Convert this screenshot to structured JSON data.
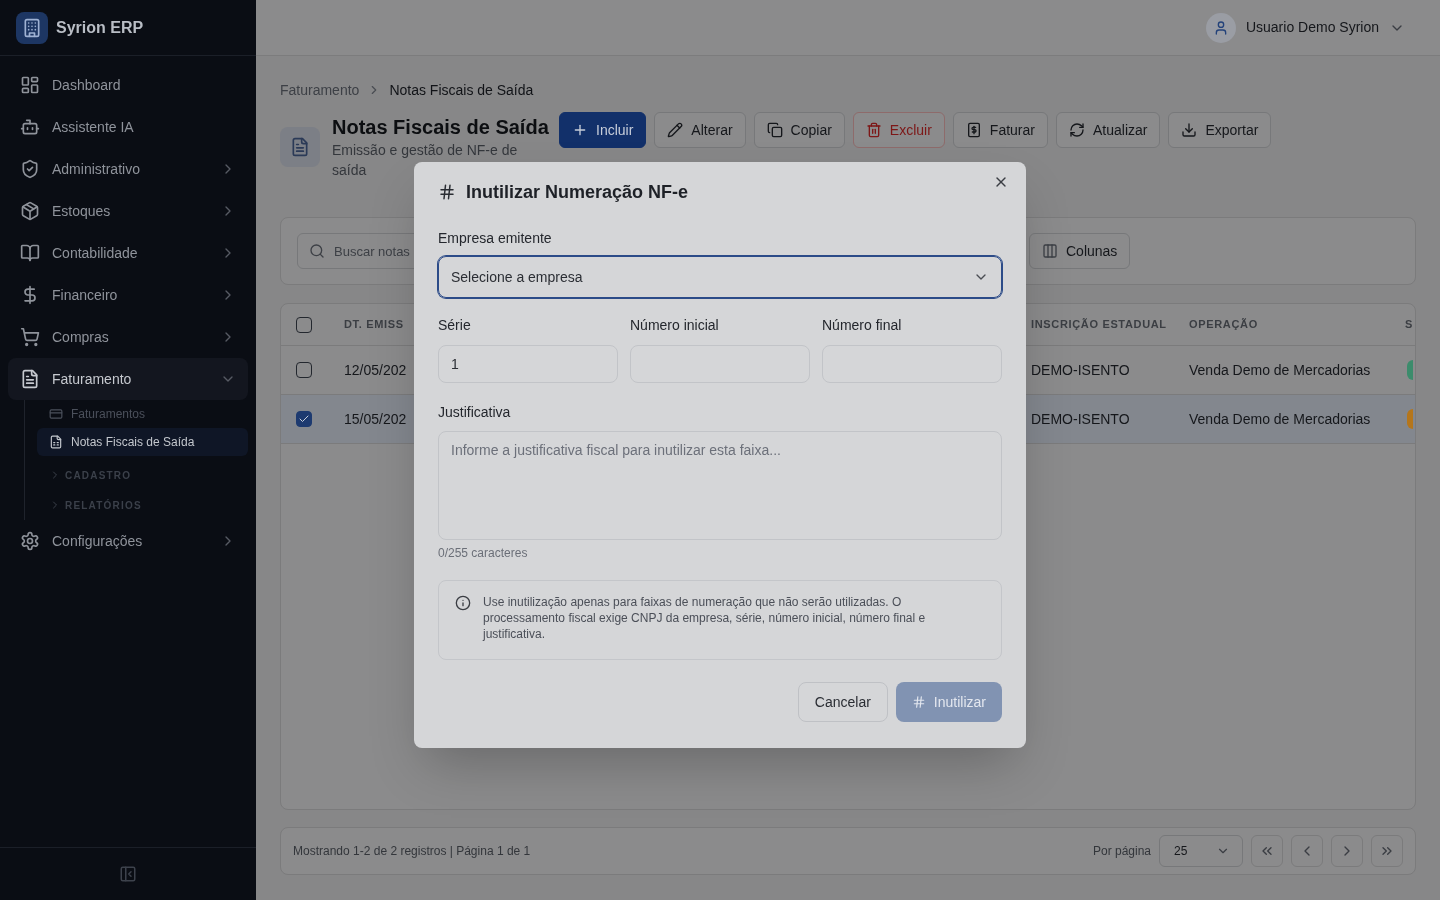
{
  "sidebar": {
    "brand": "Syrion ERP",
    "items": [
      {
        "label": "Dashboard",
        "kind": "link",
        "selected": false
      },
      {
        "label": "Assistente IA",
        "kind": "link",
        "selected": false
      },
      {
        "label": "Administrativo",
        "kind": "group",
        "selected": false,
        "expanded": false
      },
      {
        "label": "Estoques",
        "kind": "group",
        "selected": false,
        "expanded": false
      },
      {
        "label": "Contabilidade",
        "kind": "group",
        "selected": false,
        "expanded": false
      },
      {
        "label": "Financeiro",
        "kind": "group",
        "selected": false,
        "expanded": false
      },
      {
        "label": "Compras",
        "kind": "group",
        "selected": false,
        "expanded": false
      },
      {
        "label": "Faturamento",
        "kind": "group",
        "selected": true,
        "expanded": true,
        "children": [
          {
            "label": "Faturamentos",
            "kind": "link",
            "selected": false
          },
          {
            "label": "Notas Fiscais de Saída",
            "kind": "link",
            "selected": true
          },
          {
            "label": "CADASTRO",
            "kind": "section",
            "expanded": false
          },
          {
            "label": "RELATÓRIOS",
            "kind": "section",
            "expanded": false
          }
        ]
      },
      {
        "label": "Configurações",
        "kind": "group",
        "selected": false,
        "expanded": false
      }
    ]
  },
  "header": {
    "user": "Usuario Demo Syrion"
  },
  "breadcrumb": [
    "Faturamento",
    "Notas Fiscais de Saída"
  ],
  "page": {
    "title": "Notas Fiscais de Saída",
    "subtitle": "Emissão e gestão de NF-e de saída"
  },
  "toolbar": [
    {
      "label": "Incluir",
      "kind": "primary"
    },
    {
      "label": "Alterar",
      "kind": "default"
    },
    {
      "label": "Copiar",
      "kind": "default"
    },
    {
      "label": "Excluir",
      "kind": "danger"
    },
    {
      "label": "Faturar",
      "kind": "default"
    },
    {
      "label": "Atualizar",
      "kind": "default"
    },
    {
      "label": "Exportar",
      "kind": "default"
    }
  ],
  "filters": {
    "search": {
      "placeholder": "Buscar notas"
    },
    "columns_button": "Colunas"
  },
  "table": {
    "select_all": {
      "checked": false
    },
    "columns": [
      "DT. EMISS",
      "INSCRIÇÃO ESTADUAL",
      "OPERAÇÃO",
      "S"
    ],
    "rows": [
      {
        "selected": false,
        "cells": [
          "12/05/202",
          "DEMO-ISENTO",
          "Venda Demo de Mercadorias"
        ],
        "status": {
          "color": "#3c8c6c"
        }
      },
      {
        "selected": true,
        "cells": [
          "15/05/202",
          "DEMO-ISENTO",
          "Venda Demo de Mercadorias"
        ],
        "status": {
          "color": "#b5761b"
        }
      }
    ]
  },
  "pagination": {
    "summary": "Mostrando 1-2 de 2 registros | Página 1 de 1",
    "per_page_label": "Por página",
    "per_page": "25"
  },
  "modal": {
    "title": "Inutilizar Numeração NF-e",
    "fields": [
      {
        "kind": "select",
        "label": "Empresa emitente",
        "placeholder": "Selecione a empresa",
        "focused": true
      },
      {
        "kind": "input",
        "label": "Série",
        "value": "1"
      },
      {
        "kind": "input",
        "label": "Número inicial"
      },
      {
        "kind": "input",
        "label": "Número final"
      },
      {
        "kind": "textarea",
        "label": "Justificativa",
        "placeholder": "Informe a justificativa fiscal para inutilizar esta faixa...",
        "counter": "0/255 caracteres"
      }
    ],
    "note": "Use inutilização apenas para faixas de numeração que não serão utilizadas. O processamento fiscal exige CNPJ da empresa, série, número inicial, número final e justificativa.",
    "buttons": [
      {
        "label": "Cancelar",
        "kind": "secondary",
        "disabled": false
      },
      {
        "label": "Inutilizar",
        "kind": "primary",
        "disabled": true
      }
    ]
  }
}
